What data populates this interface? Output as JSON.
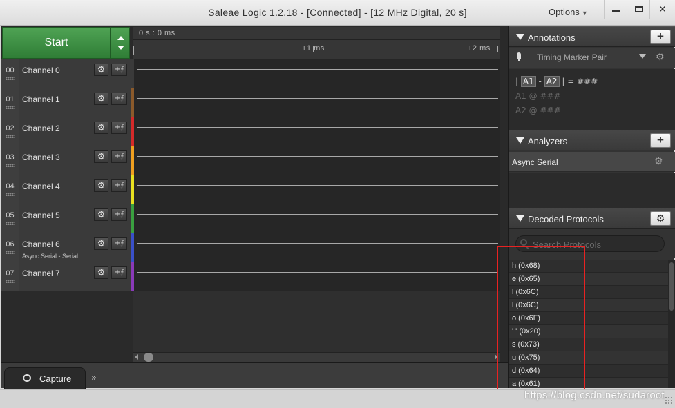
{
  "window": {
    "title": "Saleae Logic 1.2.18 - [Connected] - [12 MHz Digital, 20 s]",
    "options_label": "Options",
    "close_label": "✕"
  },
  "start": {
    "label": "Start"
  },
  "ruler": {
    "origin": "0 s : 0 ms",
    "marks": [
      "+1 ms",
      "+2 ms"
    ]
  },
  "channels": [
    {
      "num": "00",
      "name": "Channel 0",
      "sub": "",
      "color": "#3a3a3a"
    },
    {
      "num": "01",
      "name": "Channel 1",
      "sub": "",
      "color": "#8b5a2b"
    },
    {
      "num": "02",
      "name": "Channel 2",
      "sub": "",
      "color": "#d42a2a"
    },
    {
      "num": "03",
      "name": "Channel 3",
      "sub": "",
      "color": "#f0a020"
    },
    {
      "num": "04",
      "name": "Channel 4",
      "sub": "",
      "color": "#e8e020"
    },
    {
      "num": "05",
      "name": "Channel 5",
      "sub": "",
      "color": "#3aa040"
    },
    {
      "num": "06",
      "name": "Channel 6",
      "sub": "Async Serial - Serial",
      "color": "#3a50c8"
    },
    {
      "num": "07",
      "name": "Channel 7",
      "sub": "",
      "color": "#8a3ab8"
    }
  ],
  "tabs": {
    "capture": "Capture",
    "more": "»"
  },
  "annotations": {
    "title": "Annotations",
    "add": "+",
    "marker_pair": "Timing Marker Pair",
    "line1_prefix": "|",
    "a1": "A1",
    "dash": "-",
    "a2": "A2",
    "line1_suffix": "| = ###",
    "line2": "A1  @  ###",
    "line3": "A2  @  ###"
  },
  "analyzers": {
    "title": "Analyzers",
    "add": "+",
    "items": [
      "Async Serial"
    ]
  },
  "decoded": {
    "title": "Decoded Protocols",
    "search_placeholder": "Search Protocols",
    "items": [
      "h (0x68)",
      "e (0x65)",
      "l (0x6C)",
      "l (0x6C)",
      "o (0x6F)",
      "' ' (0x20)",
      "s (0x73)",
      "u (0x75)",
      "d (0x64)",
      "a (0x61)"
    ]
  },
  "watermark": "https://blog.csdn.net/sudaroot",
  "colors": {
    "accent_green": "#3f9446",
    "highlight_red": "#e82222"
  }
}
